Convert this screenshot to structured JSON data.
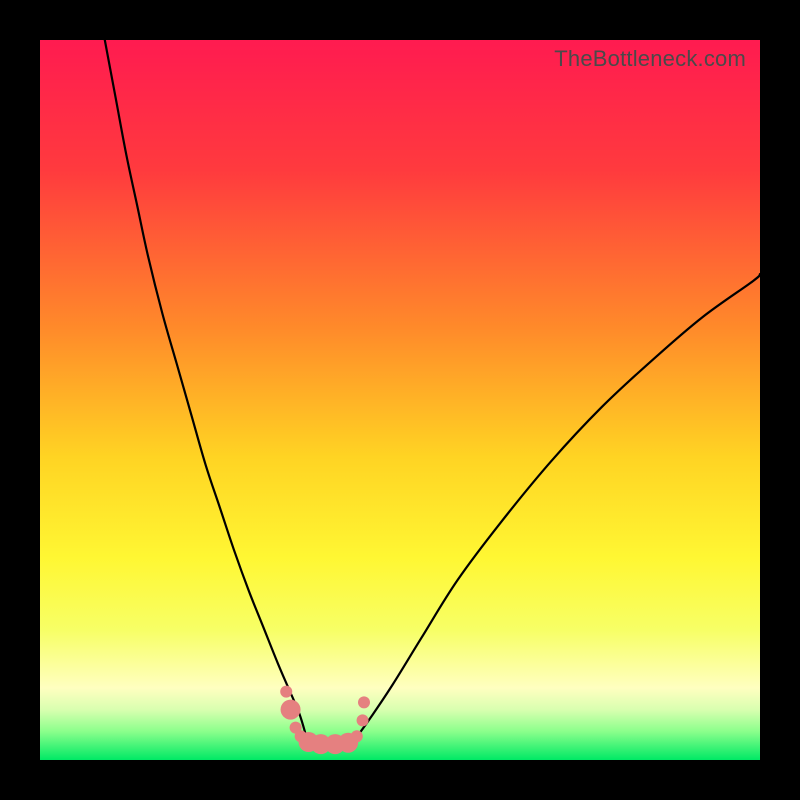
{
  "watermark": "TheBottleneck.com",
  "chart_data": {
    "type": "line",
    "title": "",
    "xlabel": "",
    "ylabel": "",
    "xlim": [
      0,
      100
    ],
    "ylim": [
      0,
      100
    ],
    "grid": false,
    "legend": false,
    "gradient_stops": [
      {
        "offset": 0.0,
        "color": "#ff1b50"
      },
      {
        "offset": 0.18,
        "color": "#ff3a3e"
      },
      {
        "offset": 0.4,
        "color": "#ff8a2a"
      },
      {
        "offset": 0.58,
        "color": "#ffd423"
      },
      {
        "offset": 0.72,
        "color": "#fff733"
      },
      {
        "offset": 0.82,
        "color": "#f7ff66"
      },
      {
        "offset": 0.9,
        "color": "#ffffc0"
      },
      {
        "offset": 0.93,
        "color": "#d9ffb0"
      },
      {
        "offset": 0.96,
        "color": "#8cff8c"
      },
      {
        "offset": 1.0,
        "color": "#00e965"
      }
    ],
    "series": [
      {
        "name": "left-branch",
        "color": "#000000",
        "width": 2.2,
        "x": [
          9,
          10.5,
          12,
          13.5,
          15,
          17,
          19,
          21,
          23,
          25,
          27,
          29,
          31,
          33,
          34.5,
          36,
          37
        ],
        "y": [
          100,
          92,
          84,
          77,
          70,
          62,
          55,
          48,
          41,
          35,
          29,
          23.5,
          18.5,
          13.5,
          10,
          6.5,
          3.2
        ]
      },
      {
        "name": "right-branch",
        "color": "#000000",
        "width": 2.2,
        "x": [
          44,
          46,
          49,
          53,
          58,
          64,
          71,
          78,
          85,
          92,
          99,
          100
        ],
        "y": [
          3.2,
          6,
          10.5,
          17,
          25,
          33,
          41.5,
          49,
          55.5,
          61.5,
          66.5,
          67.5
        ]
      },
      {
        "name": "valley-dots",
        "type": "scatter",
        "color": "#e58080",
        "radius_small": 6,
        "radius_large": 10,
        "points": [
          {
            "x": 34.2,
            "y": 9.5,
            "r": "small"
          },
          {
            "x": 34.8,
            "y": 7.0,
            "r": "large"
          },
          {
            "x": 35.5,
            "y": 4.5,
            "r": "small"
          },
          {
            "x": 36.2,
            "y": 3.3,
            "r": "small"
          },
          {
            "x": 37.3,
            "y": 2.5,
            "r": "large"
          },
          {
            "x": 39.0,
            "y": 2.2,
            "r": "large"
          },
          {
            "x": 41.0,
            "y": 2.2,
            "r": "large"
          },
          {
            "x": 42.8,
            "y": 2.4,
            "r": "large"
          },
          {
            "x": 44.0,
            "y": 3.3,
            "r": "small"
          },
          {
            "x": 44.8,
            "y": 5.5,
            "r": "small"
          },
          {
            "x": 45.0,
            "y": 8.0,
            "r": "small"
          }
        ]
      }
    ]
  }
}
